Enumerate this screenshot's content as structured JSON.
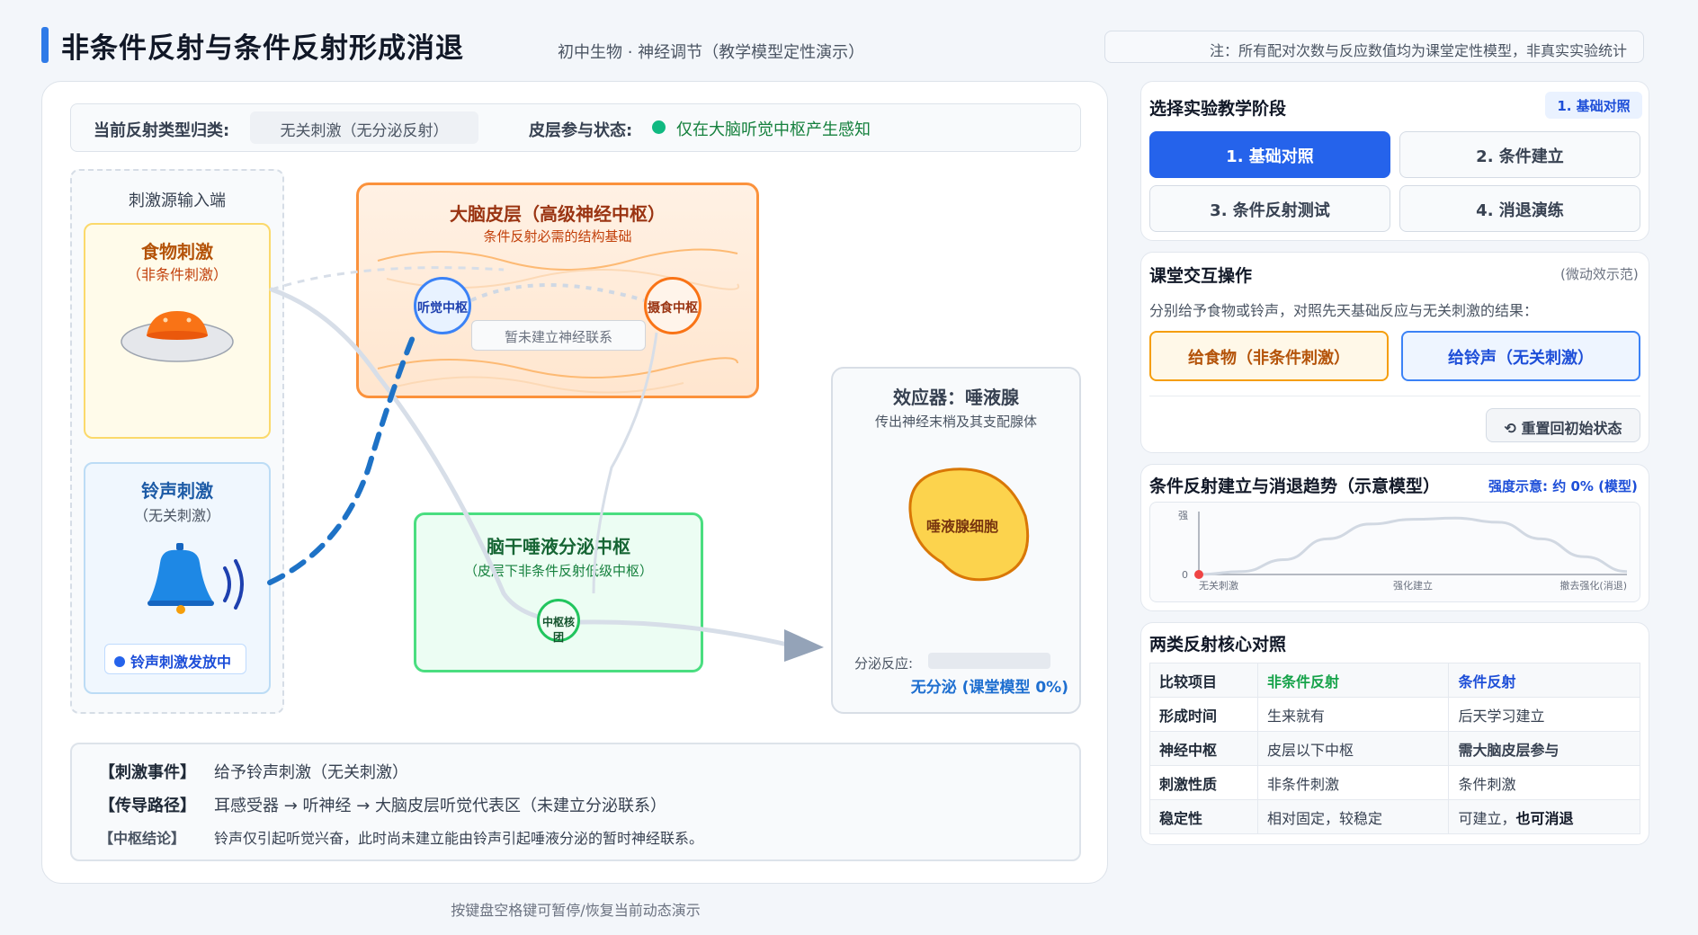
{
  "header": {
    "title": "非条件反射与条件反射形成消退",
    "subtitle": "初中生物 · 神经调节（教学模型定性演示）",
    "note": "注：所有配对次数与反应数值均为课堂定性模型，非真实实验统计"
  },
  "status": {
    "type_label": "当前反射类型归类:",
    "type_value": "无关刺激（无分泌反射）",
    "cortex_label": "皮层参与状态:",
    "cortex_value": "仅在大脑听觉中枢产生感知",
    "cortex_color": "#10b981"
  },
  "stimulus": {
    "column_title": "刺激源输入端",
    "food_title": "食物刺激",
    "food_sub": "（非条件刺激）",
    "bell_title": "铃声刺激",
    "bell_sub": "（无关刺激）",
    "bell_badge": "铃声刺激发放中"
  },
  "cortex": {
    "title": "大脑皮层（高级神经中枢）",
    "sub": "条件反射必需的结构基础",
    "node_hear": "听觉中枢",
    "node_eat": "摄食中枢",
    "no_link": "暂未建立神经联系"
  },
  "stem": {
    "title": "脑干唾液分泌中枢",
    "sub": "（皮层下非条件反射低级中枢）",
    "node": "中枢核团"
  },
  "effector": {
    "title": "效应器：唾液腺",
    "sub": "传出神经末梢及其支配腺体",
    "gland": "唾液腺细胞",
    "secrete_label": "分泌反应:",
    "secrete_value": "无分泌 (课堂模型 0%)",
    "secrete_level": 0
  },
  "log": {
    "k1": "【刺激事件】",
    "v1": "给予铃声刺激（无关刺激）",
    "k2": "【传导路径】",
    "v2": "耳感受器 → 听神经 → 大脑皮层听觉代表区（未建立分泌联系）",
    "k3": "【中枢结论】",
    "v3": "铃声仅引起听觉兴奋，此时尚未建立能由铃声引起唾液分泌的暂时神经联系。"
  },
  "footer_hint": "按键盘空格键可暂停/恢复当前动态演示",
  "stages": {
    "title": "选择实验教学阶段",
    "current": "1. 基础对照",
    "buttons": [
      "1. 基础对照",
      "2. 条件建立",
      "3. 条件反射测试",
      "4. 消退演练"
    ],
    "accent": "#2563eb"
  },
  "ops": {
    "title": "课堂交互操作",
    "hint": "(微动效示范)",
    "desc": "分别给予食物或铃声，对照先天基础反应与无关刺激的结果：",
    "food_btn": "给食物（非条件刺激）",
    "bell_btn": "给铃声（无关刺激）",
    "reset_btn": "重置回初始状态"
  },
  "trend": {
    "title": "条件反射建立与消退趋势（示意模型）",
    "strength": "强度示意: 约 0% (模型)"
  },
  "chart_data": {
    "type": "line",
    "title": "条件反射建立与消退趋势（示意模型）",
    "x": [
      0,
      0.1,
      0.2,
      0.3,
      0.4,
      0.5,
      0.6,
      0.7,
      0.8,
      0.9,
      1.0
    ],
    "x_tick_labels": [
      "无关刺激",
      "强化建立",
      "撤去强化(消退)"
    ],
    "y_tick_labels": [
      "强",
      "0"
    ],
    "series": [
      {
        "values": [
          0,
          0.05,
          0.25,
          0.6,
          0.85,
          0.93,
          0.95,
          0.88,
          0.6,
          0.3,
          0.05
        ]
      }
    ],
    "current_point": {
      "x": 0,
      "y": 0
    },
    "ylim": [
      0,
      1
    ],
    "grid": false
  },
  "compare": {
    "title": "两类反射核心对照",
    "header": [
      "比较项目",
      "非条件反射",
      "条件反射"
    ],
    "rows": [
      [
        "形成时间",
        "生来就有",
        "后天学习建立"
      ],
      [
        "神经中枢",
        "皮层以下中枢",
        "需大脑皮层参与"
      ],
      [
        "刺激性质",
        "非条件刺激",
        "条件刺激"
      ],
      [
        "稳定性",
        "相对固定，较稳定",
        "可建立，",
        "也可消退"
      ]
    ]
  }
}
